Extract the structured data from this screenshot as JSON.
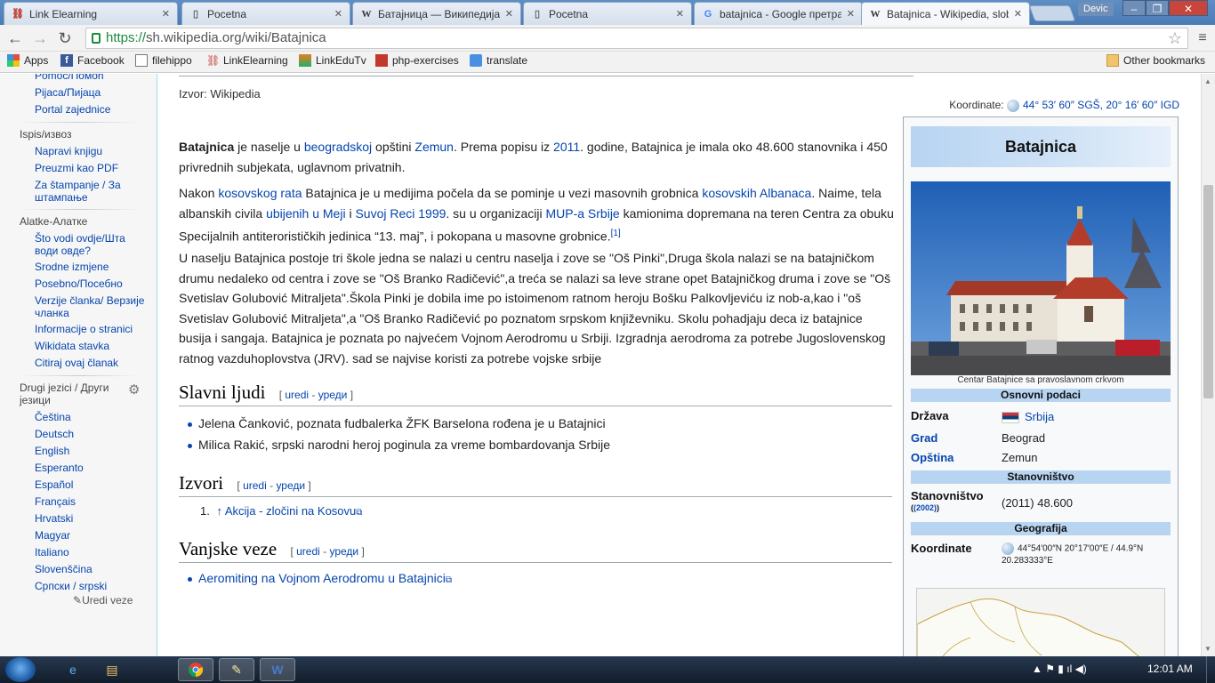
{
  "browser": {
    "tabs": [
      {
        "title": "Link Elearning",
        "icon": "link-icon"
      },
      {
        "title": "Pocetna",
        "icon": "page-icon"
      },
      {
        "title": "Батајница — Википедија,",
        "icon": "wikipedia-icon"
      },
      {
        "title": "Pocetna",
        "icon": "page-icon"
      },
      {
        "title": "batajnica - Google претра",
        "icon": "google-icon"
      },
      {
        "title": "Batajnica - Wikipedia, slob",
        "icon": "wikipedia-icon"
      }
    ],
    "profile": "Devic",
    "window_buttons": [
      "–",
      "❐",
      "✕"
    ],
    "url_scheme": "https://",
    "url_rest": "sh.wikipedia.org/wiki/Batajnica"
  },
  "bookmarks": {
    "items": [
      "Apps",
      "Facebook",
      "filehippo",
      "LinkElearning",
      "LinkEduTv",
      "php-exercises",
      "translate"
    ],
    "other": "Other bookmarks"
  },
  "sidebar": {
    "top_links": [
      "Pomoć/Помоћ",
      "Pijaca/Пијаца",
      "Portal zajednice"
    ],
    "print_heading": "Ispis/извоз",
    "print_links": [
      "Napravi knjigu",
      "Preuzmi kao PDF",
      "Za štampanje / За штампање"
    ],
    "tools_heading": "Alatke-Алатке",
    "tools_links": [
      "Što vodi ovdje/Шта води овде?",
      "Srodne izmjene",
      "Posebno/Посебно",
      "Verzije članka/ Верзије чланка",
      "Informacije o stranici",
      "Wikidata stavka",
      "Citiraj ovaj članak"
    ],
    "lang_heading": "Drugi jezici / Други језици",
    "languages": [
      "Čeština",
      "Deutsch",
      "English",
      "Esperanto",
      "Español",
      "Français",
      "Hrvatski",
      "Magyar",
      "Italiano",
      "Slovenščina",
      "Српски / srpski"
    ],
    "edit_links": "Uredi veze"
  },
  "article": {
    "source": "Izvor: Wikipedia",
    "coords_label": "Koordinate:",
    "coords_value": "44° 53′ 60″ SGŠ, 20° 16′ 60″ IGD",
    "p1": {
      "bold": "Batajnica",
      "t1": " je naselje u ",
      "l1": "beogradskoj",
      "t2": " opštini ",
      "l2": "Zemun",
      "t3": ". Prema popisu iz ",
      "l3": "2011",
      "t4": ". godine, Batajnica je imala oko 48.600 stanovnika i 450 privrednih subjekata, uglavnom privatnih."
    },
    "p2": {
      "t1": "Nakon ",
      "l1": "kosovskog rata",
      "t2": " Batajnica je u medijima počela da se pominje u vezi masovnih grobnica ",
      "l2": "kosovskih Albanaca",
      "t3": ". Naime, tela albanskih civila ",
      "l3": "ubijenih u Meji",
      "t4": " i ",
      "l4": "Suvoj Reci 1999",
      "t5": ". su u organizaciji ",
      "l5": "MUP-a Srbije",
      "t6": " kamionima dopremana na teren Centra za obuku Specijalnih antiterorističkih jedinica “13. maj”, i pokopana u masovne grobnice.",
      "ref": "[1]"
    },
    "p3": "U naselju Batajnica postoje tri škole jedna se nalazi u centru naselja i zove se \"Oš Pinki\",Druga škola nalazi se na batajničkom drumu nedaleko od centra i zove se \"Oš Branko Radičević\",a treća se nalazi sa leve strane opet Batajničkog druma i zove se \"Oš Svetislav Golubović Mitraljeta\".Škola Pinki je dobila ime po istoimenom ratnom heroju Bošku Palkovljeviću iz nob-a,kao i \"oš Svetislav Golubović Mitraljeta\",a \"Oš Branko Radičević po poznatom srpskom književniku. Skolu pohadjaju deca iz batajnice busija i sangaja. Batajnica je poznata po najvećem Vojnom Aerodromu u Srbiji. Izgradnja aerodroma za potrebe Jugoslovenskog ratnog vazduhoplovstva (JRV). sad se najvise koristi za potrebe vojske srbije",
    "edit_open": "[ ",
    "edit_a": "uredi",
    "edit_sep": " - ",
    "edit_b": "уреди",
    "edit_close": " ]",
    "sec1_title": "Slavni ljudi",
    "sec1_items": [
      "Jelena Čanković, poznata fudbalerka ŽFK Barselona rođena je u Batajnici",
      "Milica Rakić, srpski narodni heroj poginula za vreme bombardovanja Srbije"
    ],
    "sec2_title": "Izvori",
    "sec2_ref_num": "1.",
    "sec2_ref": "↑ Akcija - zločini na Kosovu",
    "sec3_title": "Vanjske veze",
    "sec3_link": "Aeromiting na Vojnom Aerodromu u Batajnici"
  },
  "infobox": {
    "title": "Batajnica",
    "caption": "Centar Batajnice sa pravoslavnom crkvom",
    "basic_head": "Osnovni podaci",
    "drzava_label": "Država",
    "drzava_value": "Srbija",
    "grad_label": "Grad",
    "grad_value": "Beograd",
    "opstina_label": "Opština",
    "opstina_value": "Zemun",
    "pop_head": "Stanovništvo",
    "pop_label": "Stanovništvo",
    "pop_year": "(2002)",
    "pop_value": "(2011) 48.600",
    "geo_head": "Geografija",
    "coord_label": "Koordinate",
    "coord_value": "44°54′00″N 20°17′00″E / 44.9°N 20.283333°E"
  },
  "taskbar": {
    "clock": "12:01 AM",
    "tray": "▲  ⚑  ▮  ıl  ◀)"
  }
}
